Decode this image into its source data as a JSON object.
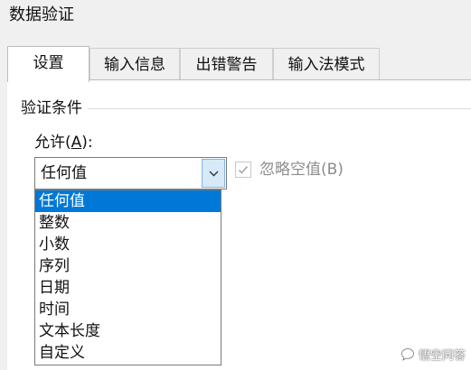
{
  "window": {
    "title": "数据验证"
  },
  "tabs": [
    {
      "label": "设置",
      "active": true
    },
    {
      "label": "输入信息",
      "active": false
    },
    {
      "label": "出错警告",
      "active": false
    },
    {
      "label": "输入法模式",
      "active": false
    }
  ],
  "settings": {
    "group_label": "验证条件",
    "allow": {
      "label_prefix": "允许(",
      "accel_key": "A",
      "label_suffix": "):",
      "value": "任何值",
      "options": [
        "任何值",
        "整数",
        "小数",
        "序列",
        "日期",
        "时间",
        "文本长度",
        "自定义"
      ],
      "selected_index": 0
    },
    "ignore_blank": {
      "label": "忽略空值(B)",
      "checked": true,
      "enabled": false
    }
  },
  "watermark": {
    "text": "悟空问答"
  },
  "colors": {
    "selection": "#0078d7",
    "combo_button_bg": "#d7eaf9",
    "window_bg": "#f0f0f0"
  }
}
